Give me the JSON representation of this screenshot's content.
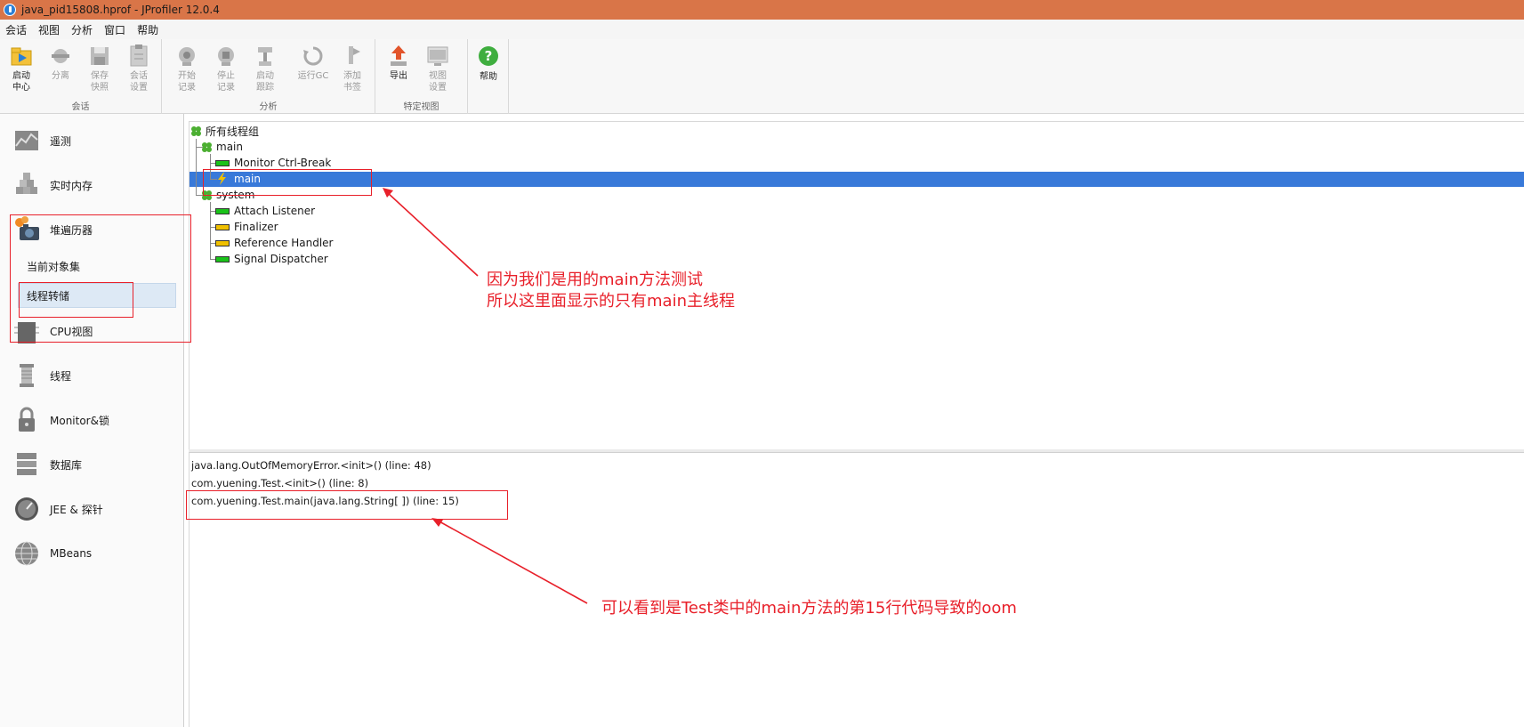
{
  "window": {
    "title": "java_pid15808.hprof - JProfiler 12.0.4"
  },
  "menu": [
    "会话",
    "视图",
    "分析",
    "窗口",
    "帮助"
  ],
  "toolbar": {
    "groups": [
      {
        "label": "会话",
        "buttons": [
          {
            "label": "启动\n中心",
            "icon": "start-center-icon",
            "enabled": true
          },
          {
            "label": "分离",
            "icon": "detach-icon",
            "enabled": false
          },
          {
            "label": "保存\n快照",
            "icon": "save-snapshot-icon",
            "enabled": false
          },
          {
            "label": "会话\n设置",
            "icon": "session-settings-icon",
            "enabled": false
          }
        ]
      },
      {
        "label": "分析",
        "buttons": [
          {
            "label": "开始\n记录",
            "icon": "start-recording-icon",
            "enabled": false
          },
          {
            "label": "停止\n记录",
            "icon": "stop-recording-icon",
            "enabled": false
          },
          {
            "label": "启动\n跟踪",
            "icon": "start-tracking-icon",
            "enabled": false
          },
          {
            "label": "运行GC",
            "icon": "run-gc-icon",
            "enabled": false
          },
          {
            "label": "添加\n书签",
            "icon": "add-bookmark-icon",
            "enabled": false
          }
        ]
      },
      {
        "label": "特定视图",
        "buttons": [
          {
            "label": "导出",
            "icon": "export-icon",
            "enabled": true
          },
          {
            "label": "视图\n设置",
            "icon": "view-settings-icon",
            "enabled": false
          }
        ]
      },
      {
        "label": "",
        "buttons": [
          {
            "label": "帮助",
            "icon": "help-icon",
            "enabled": true
          }
        ]
      }
    ]
  },
  "sidebar": {
    "items": [
      {
        "label": "遥测",
        "icon": "telemetry-icon"
      },
      {
        "label": "实时内存",
        "icon": "live-memory-icon"
      },
      {
        "label": "堆遍历器",
        "icon": "heap-walker-icon"
      },
      {
        "label": "CPU视图",
        "icon": "cpu-views-icon"
      },
      {
        "label": "线程",
        "icon": "threads-icon"
      },
      {
        "label": "Monitor&锁",
        "icon": "monitor-lock-icon"
      },
      {
        "label": "数据库",
        "icon": "database-icon"
      },
      {
        "label": "JEE & 探针",
        "icon": "jee-probes-icon"
      },
      {
        "label": "MBeans",
        "icon": "mbeans-icon"
      }
    ],
    "heap_subitems": [
      "当前对象集",
      "线程转储"
    ],
    "selected_subitem": "线程转储"
  },
  "thread_tree": {
    "root": "所有线程组",
    "groups": [
      {
        "name": "main",
        "threads": [
          {
            "name": "Monitor Ctrl-Break",
            "state": "running",
            "color": "#1ac21a"
          },
          {
            "name": "main",
            "state": "selected",
            "color": "#f0c000"
          }
        ]
      },
      {
        "name": "system",
        "threads": [
          {
            "name": "Attach Listener",
            "state": "running",
            "color": "#1ac21a"
          },
          {
            "name": "Finalizer",
            "state": "waiting",
            "color": "#f0c000"
          },
          {
            "name": "Reference Handler",
            "state": "waiting",
            "color": "#f0c000"
          },
          {
            "name": "Signal Dispatcher",
            "state": "running",
            "color": "#1ac21a"
          }
        ]
      }
    ]
  },
  "stack_trace": [
    "java.lang.OutOfMemoryError.<init>() (line: 48)",
    "com.yuening.Test.<init>() (line: 8)",
    "com.yuening.Test.main(java.lang.String[ ]) (line: 15)"
  ],
  "annotations": {
    "note1_line1": "因为我们是用的main方法测试",
    "note1_line2": "所以这里面显示的只有main主线程",
    "note2": "可以看到是Test类中的main方法的第15行代码导致的oom"
  },
  "colors": {
    "titlebar": "#d97548",
    "selection": "#3879d9",
    "annotation": "#e8202a"
  }
}
